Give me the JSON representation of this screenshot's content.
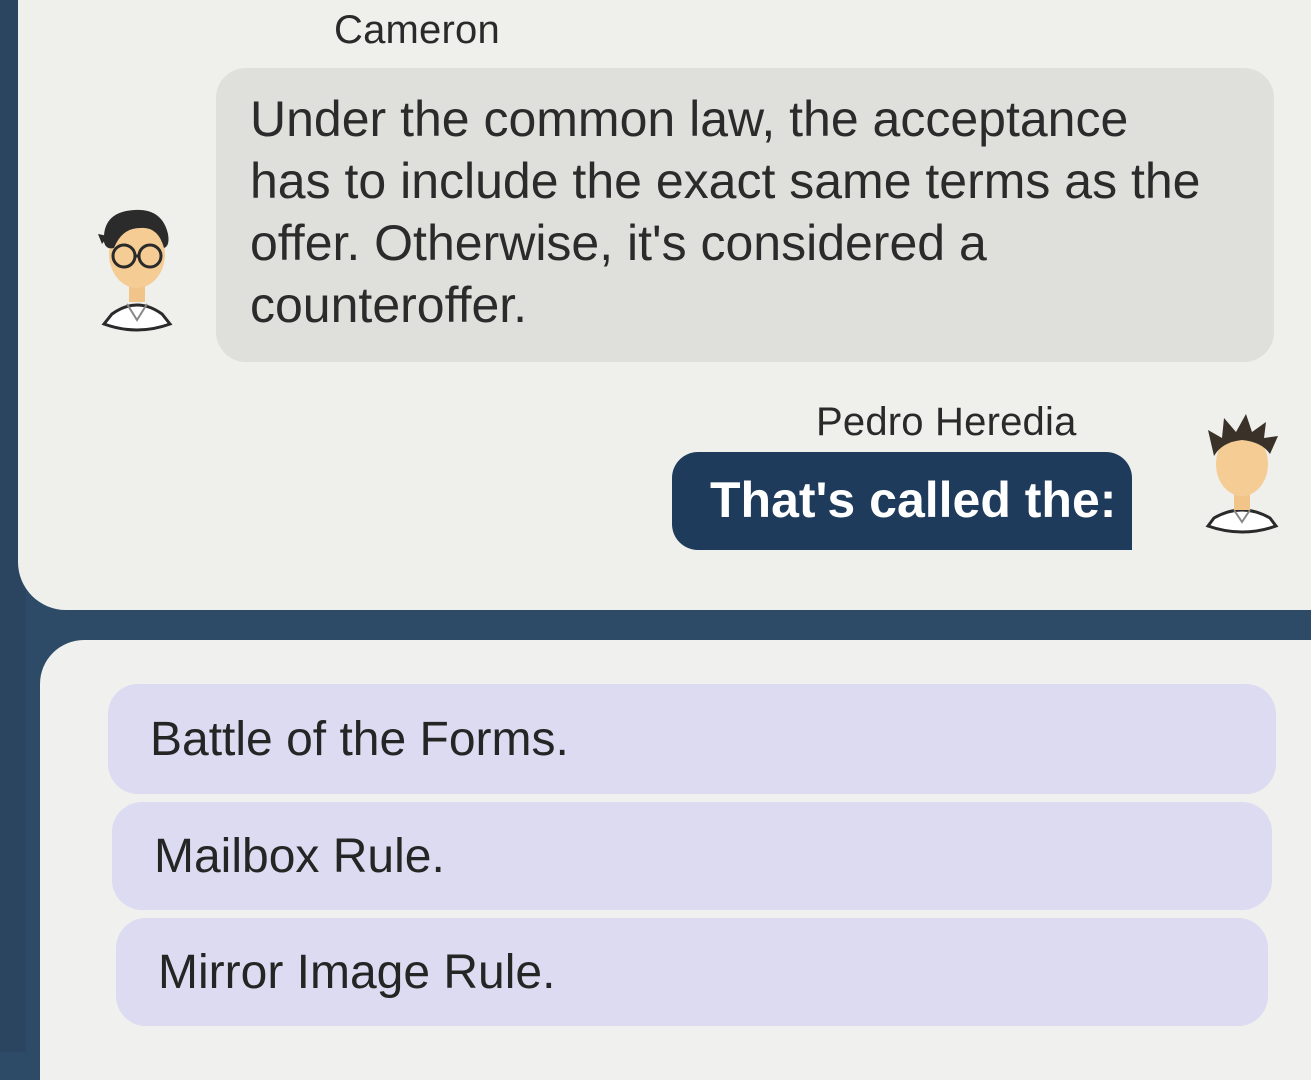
{
  "conversation": {
    "speaker_1": {
      "name": "Cameron",
      "avatar_icon": "person-with-glasses-avatar-icon",
      "message": "Under the common law, the acceptance has to include the exact same terms as the offer. Otherwise, it's considered a counteroffer."
    },
    "speaker_2": {
      "name": "Pedro Heredia",
      "avatar_icon": "person-spiky-hair-avatar-icon",
      "message": "That's called the:"
    }
  },
  "answers": {
    "options": [
      "Battle of the Forms.",
      "Mailbox Rule.",
      "Mirror Image Rule."
    ]
  },
  "colors": {
    "frame": "#2d4a66",
    "chat_background": "#efefec",
    "incoming_bubble": "#dfdfdb",
    "outgoing_bubble": "#1f3b5c",
    "option_background": "#dcdbf1"
  }
}
